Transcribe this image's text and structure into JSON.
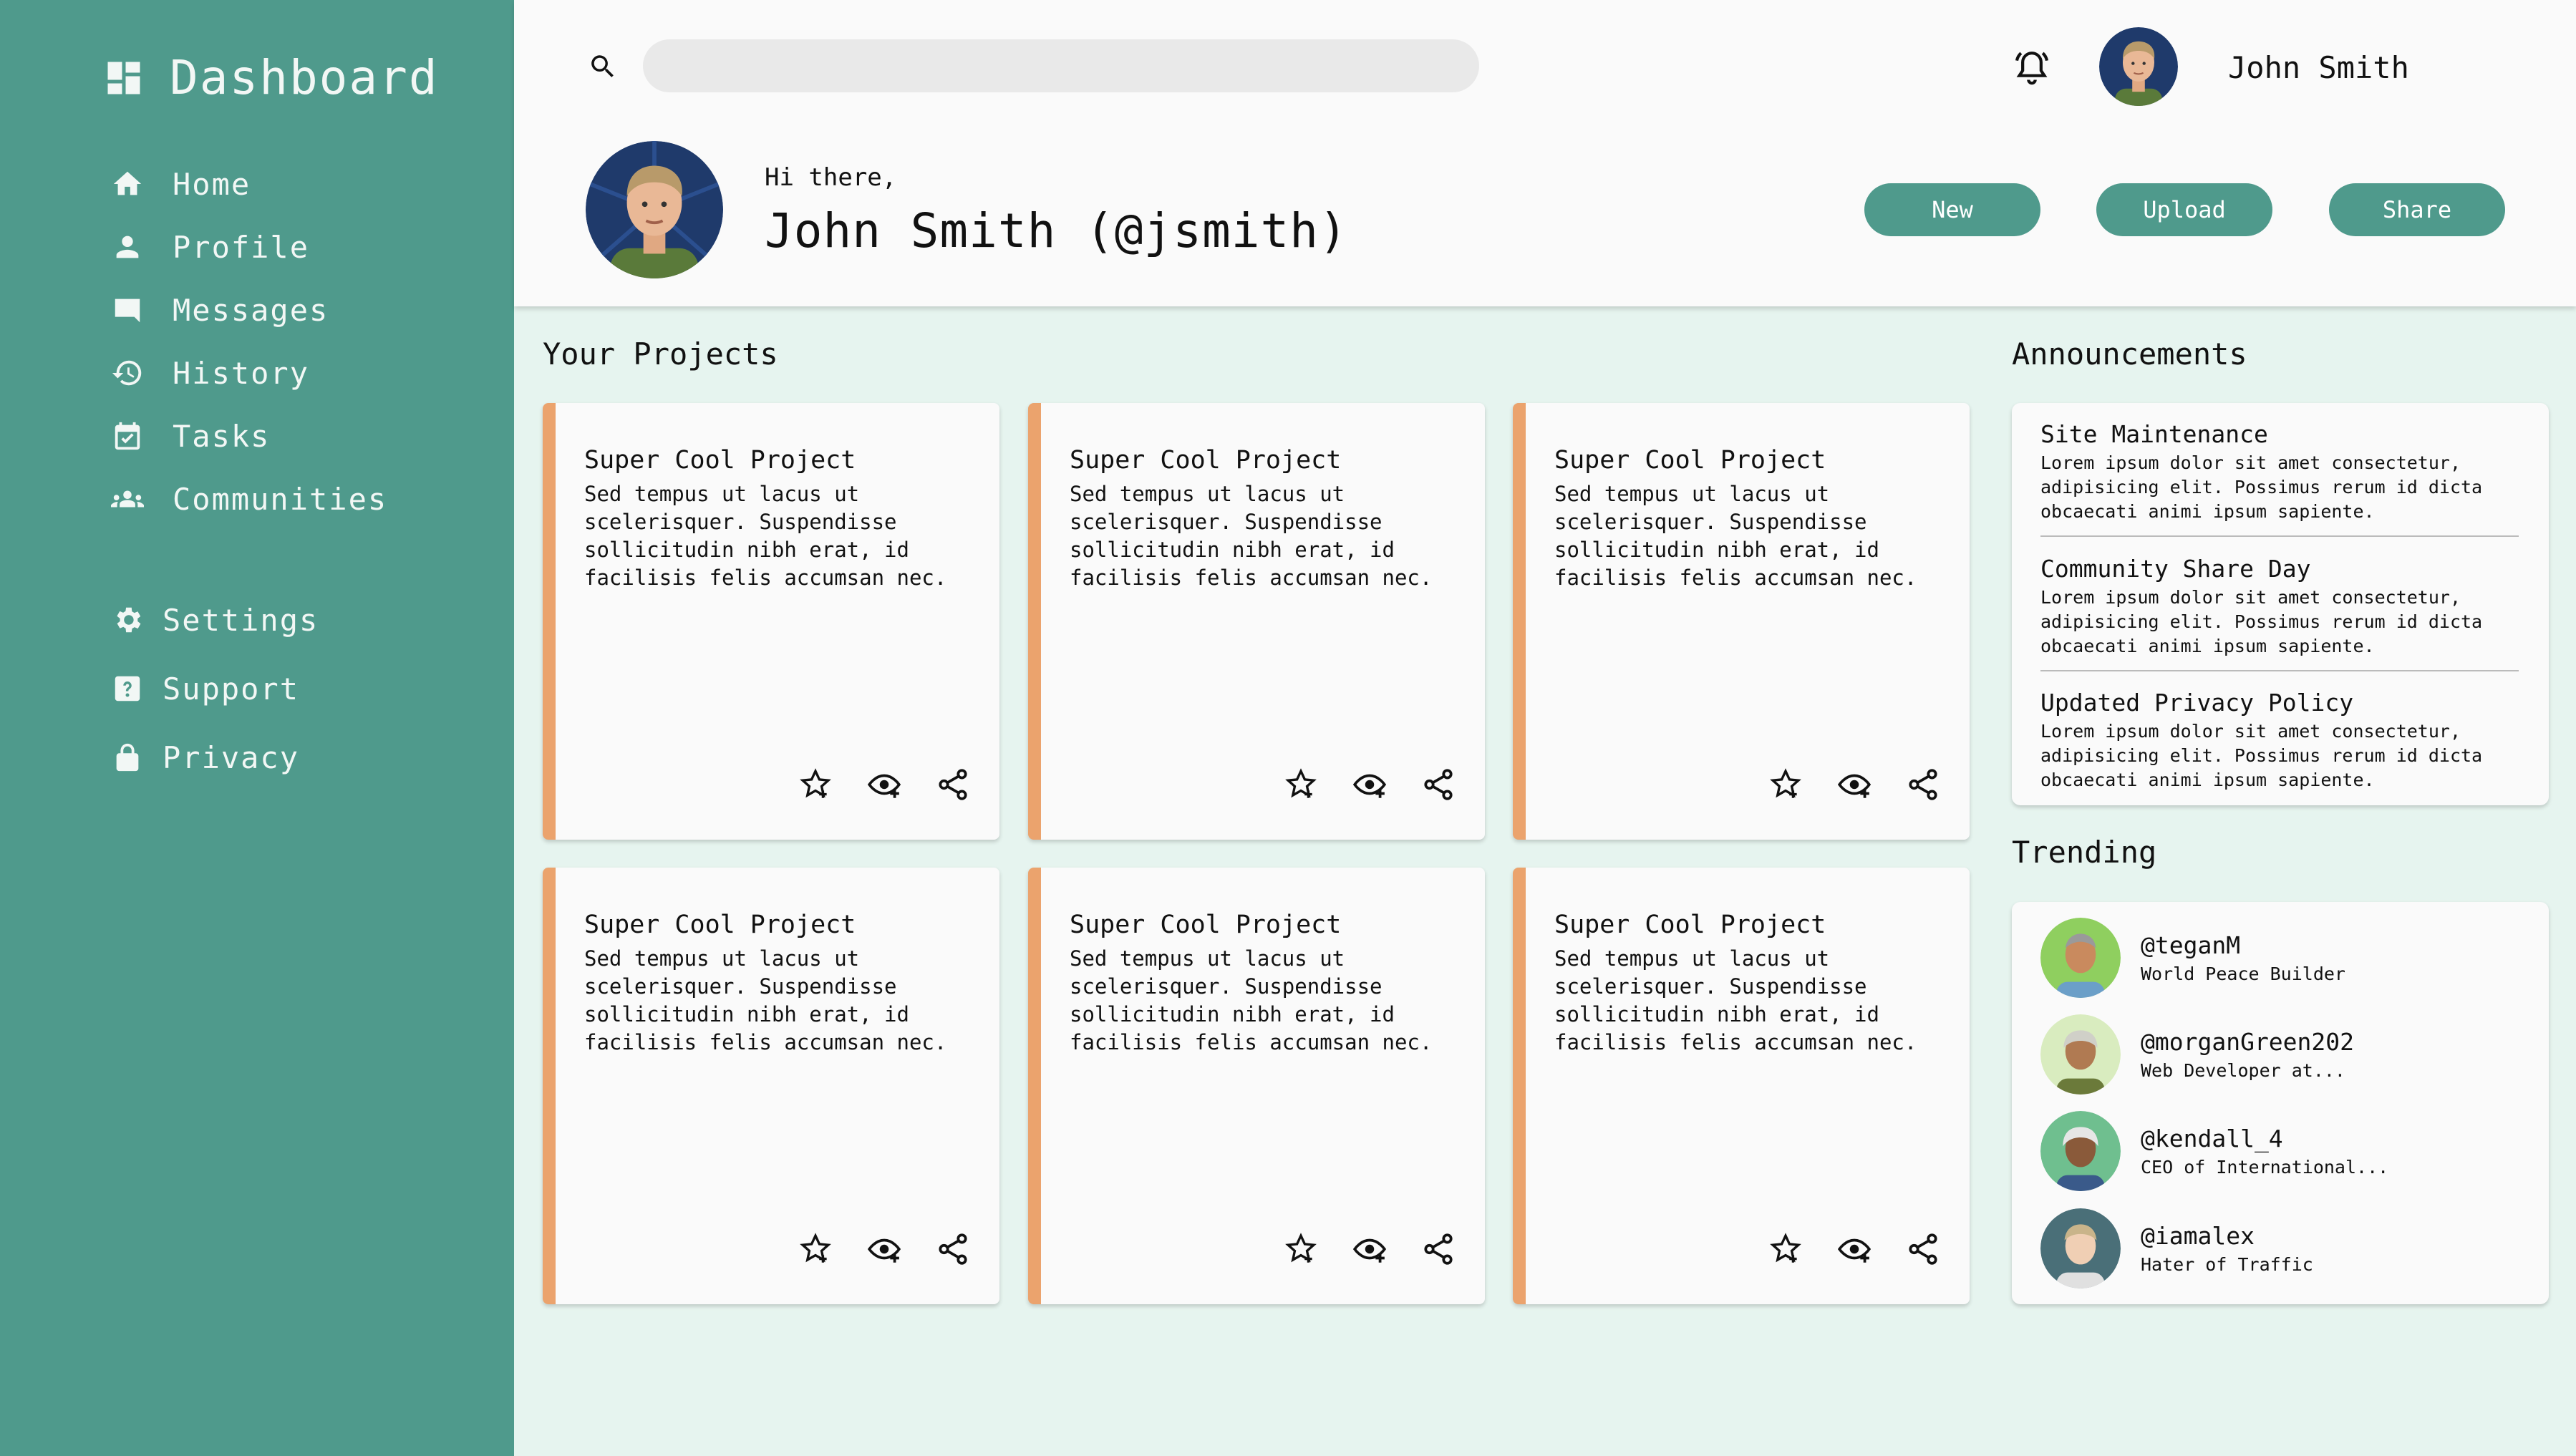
{
  "sidebar": {
    "brand": "Dashboard",
    "nav": [
      {
        "label": "Home",
        "icon": "home-icon"
      },
      {
        "label": "Profile",
        "icon": "person-icon"
      },
      {
        "label": "Messages",
        "icon": "chat-icon"
      },
      {
        "label": "History",
        "icon": "history-icon"
      },
      {
        "label": "Tasks",
        "icon": "calendar-icon"
      },
      {
        "label": "Communities",
        "icon": "group-icon"
      }
    ],
    "nav_secondary": [
      {
        "label": "Settings",
        "icon": "gear-icon"
      },
      {
        "label": "Support",
        "icon": "help-icon"
      },
      {
        "label": "Privacy",
        "icon": "lock-icon"
      }
    ]
  },
  "header": {
    "search_placeholder": "",
    "user_name": "John Smith",
    "greeting": "Hi there,",
    "full_name": "John Smith (@jsmith)",
    "buttons": {
      "new": "New",
      "upload": "Upload",
      "share": "Share"
    }
  },
  "projects": {
    "title": "Your Projects",
    "items": [
      {
        "title": "Super Cool Project",
        "desc": "Sed tempus ut lacus ut scelerisquer. Suspendisse sollicitudin nibh erat, id facilisis felis accumsan nec."
      },
      {
        "title": "Super Cool Project",
        "desc": "Sed tempus ut lacus ut scelerisquer. Suspendisse sollicitudin nibh erat, id facilisis felis accumsan nec."
      },
      {
        "title": "Super Cool Project",
        "desc": "Sed tempus ut lacus ut scelerisquer. Suspendisse sollicitudin nibh erat, id facilisis felis accumsan nec."
      },
      {
        "title": "Super Cool Project",
        "desc": "Sed tempus ut lacus ut scelerisquer. Suspendisse sollicitudin nibh erat, id facilisis felis accumsan nec."
      },
      {
        "title": "Super Cool Project",
        "desc": "Sed tempus ut lacus ut scelerisquer. Suspendisse sollicitudin nibh erat, id facilisis felis accumsan nec."
      },
      {
        "title": "Super Cool Project",
        "desc": "Sed tempus ut lacus ut scelerisquer. Suspendisse sollicitudin nibh erat, id facilisis felis accumsan nec."
      }
    ]
  },
  "announcements": {
    "title": "Announcements",
    "items": [
      {
        "title": "Site Maintenance",
        "body": "Lorem ipsum dolor sit amet consectetur, adipisicing elit. Possimus rerum id dicta obcaecati animi ipsum sapiente."
      },
      {
        "title": "Community Share Day",
        "body": "Lorem ipsum dolor sit amet consectetur, adipisicing elit. Possimus rerum id dicta obcaecati animi ipsum sapiente."
      },
      {
        "title": "Updated Privacy Policy",
        "body": "Lorem ipsum dolor sit amet consectetur, adipisicing elit. Possimus rerum id dicta obcaecati animi ipsum sapiente."
      }
    ]
  },
  "trending": {
    "title": "Trending",
    "items": [
      {
        "handle": "@teganM",
        "sub": "World Peace Builder",
        "bg": "#8fcf5f"
      },
      {
        "handle": "@morganGreen202",
        "sub": "Web Developer at...",
        "bg": "#d9ecbf"
      },
      {
        "handle": "@kendall_4",
        "sub": "CEO of International...",
        "bg": "#6fbf8f"
      },
      {
        "handle": "@iamalex",
        "sub": "Hater of Traffic",
        "bg": "#4a6f78"
      }
    ]
  },
  "colors": {
    "sidebar": "#4f9a8c",
    "accent": "#eba36d",
    "main_bg": "#e6f4ef"
  }
}
